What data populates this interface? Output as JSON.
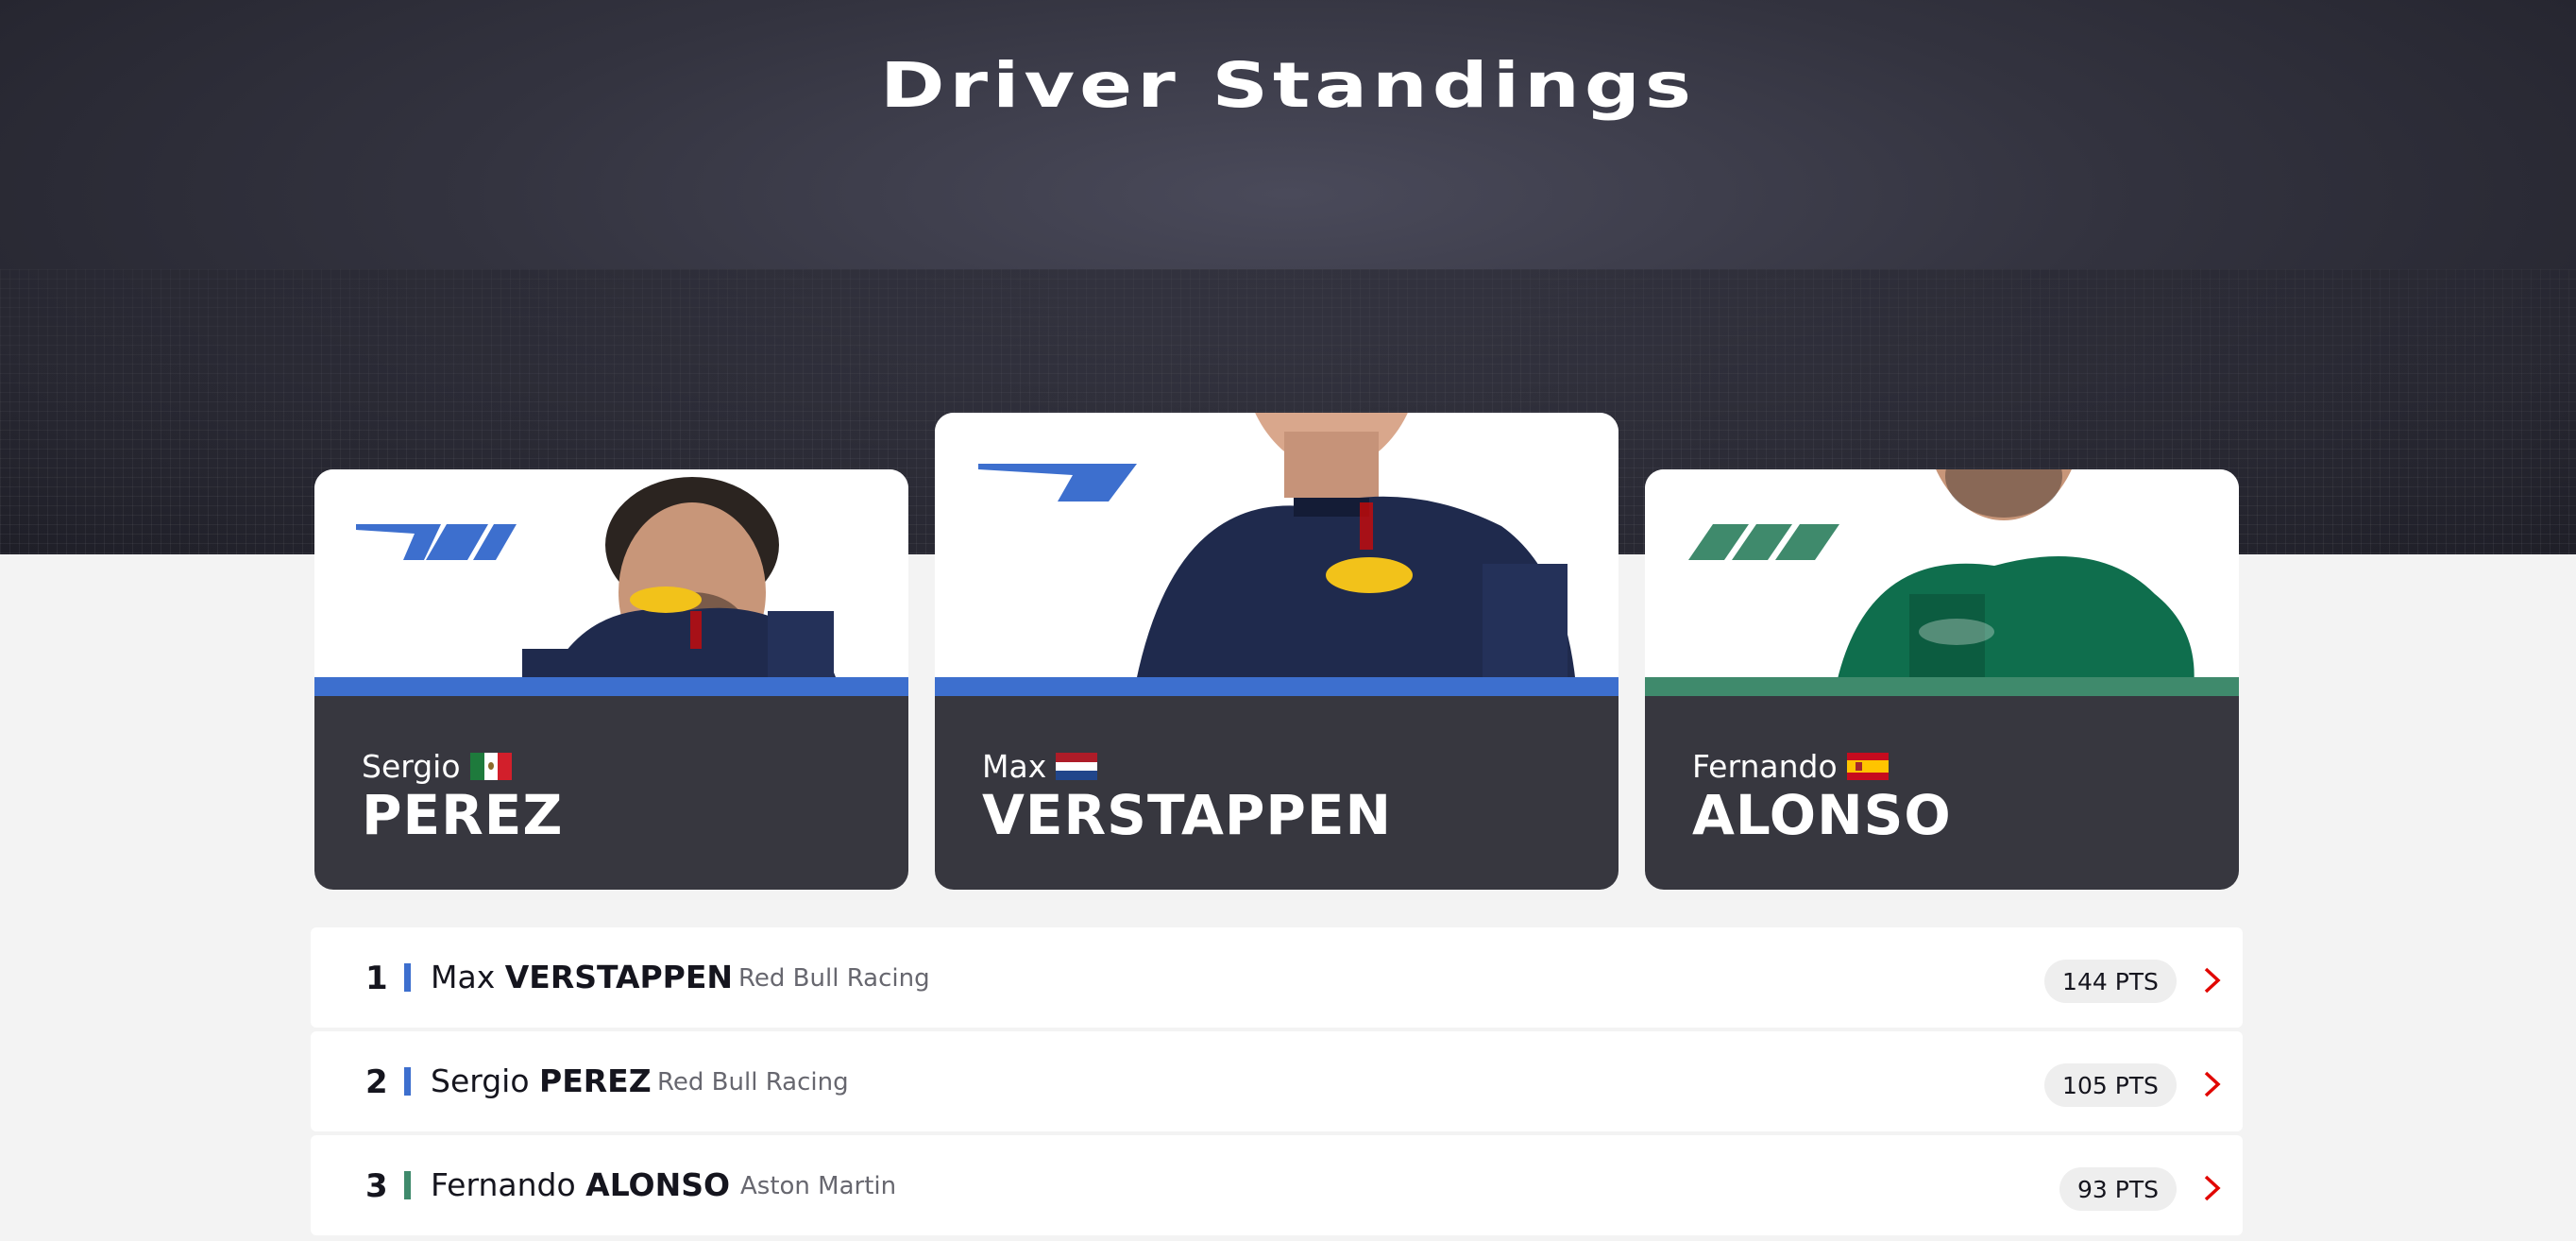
{
  "header": {
    "title": "Driver Standings"
  },
  "podium": [
    {
      "position_slot": "left",
      "first_name": "Sergio",
      "last_name": "PEREZ",
      "flag": "mexico-flag",
      "team_color": "#3671c6",
      "team_logo": "red-bull-logo"
    },
    {
      "position_slot": "center",
      "first_name": "Max",
      "last_name": "VERSTAPPEN",
      "flag": "netherlands-flag",
      "team_color": "#3671c6",
      "team_logo": "red-bull-logo"
    },
    {
      "position_slot": "right",
      "first_name": "Fernando",
      "last_name": "ALONSO",
      "flag": "spain-flag",
      "team_color": "#358c75",
      "team_logo": "aston-martin-logo"
    }
  ],
  "standings": [
    {
      "position": "1",
      "first_name": "Max",
      "last_name": "VERSTAPPEN",
      "team": "Red Bull Racing",
      "points": "144 PTS",
      "team_color": "#3671c6"
    },
    {
      "position": "2",
      "first_name": "Sergio",
      "last_name": "PEREZ",
      "team": "Red Bull Racing",
      "points": "105 PTS",
      "team_color": "#3671c6"
    },
    {
      "position": "3",
      "first_name": "Fernando",
      "last_name": "ALONSO",
      "team": "Aston Martin",
      "points": "93 PTS",
      "team_color": "#358c75"
    }
  ],
  "colors": {
    "accent_red": "#e10600",
    "card_dark": "#37373f"
  }
}
